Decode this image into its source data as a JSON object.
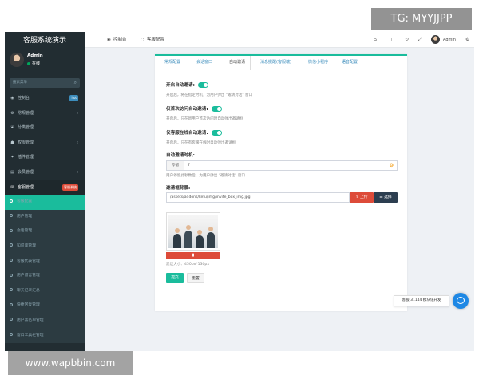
{
  "watermarks": {
    "top": "TG: MYYJJPP",
    "bottom": "www.wapbbin.com"
  },
  "sidebar": {
    "brand": "客服系统演示",
    "user": {
      "name": "Admin",
      "status": "在线"
    },
    "search_placeholder": "搜索菜单",
    "items": [
      {
        "label": "控制台",
        "icon": "dashboard-icon",
        "badge": "hot"
      },
      {
        "label": "常规管理",
        "icon": "cog-icon"
      },
      {
        "label": "分类管理",
        "icon": "leaf-icon"
      },
      {
        "label": "权限管理",
        "icon": "group-icon"
      },
      {
        "label": "插件管理",
        "icon": "plug-icon"
      },
      {
        "label": "会员管理",
        "icon": "user-icon"
      },
      {
        "label": "客服管理",
        "icon": "comment-icon",
        "badge": "客服系统"
      }
    ],
    "subitems": [
      "客服配置",
      "用户管理",
      "会话管理",
      "知识库管理",
      "客服代表管理",
      "用户留言管理",
      "聊天记录汇总",
      "快捷回复管理",
      "用户黑名单管理",
      "窗口工具栏管理"
    ]
  },
  "topbar": {
    "tabs": [
      {
        "label": "控制台",
        "icon": "dashboard-icon"
      },
      {
        "label": "客服配置",
        "icon": "circle-icon"
      }
    ],
    "admin": "Admin"
  },
  "panel": {
    "tabs": [
      "常规配置",
      "会话窗口",
      "自动邀请",
      "消息提醒(客服端)",
      "微信小程序",
      "语音配置"
    ],
    "active_tab": 2,
    "fields": {
      "auto_invite": {
        "label": "开启自动邀请:",
        "help": "开启后，将在指定时机，为用户弹出 \"邀请对话\" 窗口"
      },
      "first_visit": {
        "label": "仅首次访问自动邀请:",
        "help": "开启后，只在新用户首次访问时自动弹出邀请框"
      },
      "online_only": {
        "label": "仅客服在线自动邀请:",
        "help": "开启后，只在有客服在线时自动弹出邀请框"
      },
      "invite_time": {
        "label": "自动邀请时机:",
        "prefix": "停留",
        "value": "7",
        "help": "用户停留此秒数后，为用户弹出 \"邀请对话\" 窗口"
      },
      "invite_bg": {
        "label": "邀请框背景:",
        "value": "/assets/addons/kefu/img/invite_box_img.jpg",
        "upload": "上传",
        "choose": "选择",
        "size_hint": "建议大小：450px*130px"
      }
    },
    "submit": "提交",
    "reset": "重置"
  },
  "float_tip": "客服 31144 模块化开发"
}
